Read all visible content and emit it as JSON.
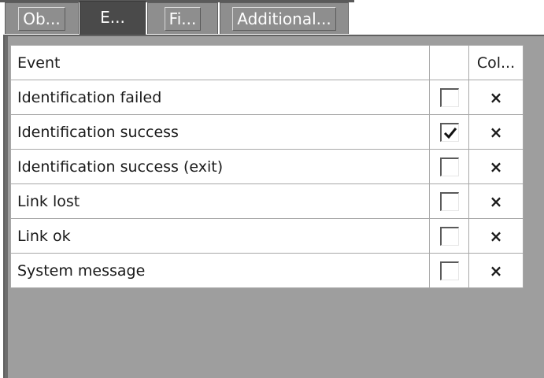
{
  "tabs": [
    {
      "label": "Ob...",
      "active": false
    },
    {
      "label": "E...",
      "active": true
    },
    {
      "label": "Fi...",
      "active": false
    },
    {
      "label": "Additional...",
      "active": false
    }
  ],
  "grid": {
    "headers": {
      "event": "Event",
      "check": "",
      "col": "Col..."
    },
    "rows": [
      {
        "event": "Identification failed",
        "checked": false,
        "action": "×"
      },
      {
        "event": "Identification success",
        "checked": true,
        "action": "×"
      },
      {
        "event": "Identification success (exit)",
        "checked": false,
        "action": "×"
      },
      {
        "event": "Link lost",
        "checked": false,
        "action": "×"
      },
      {
        "event": "Link ok",
        "checked": false,
        "action": "×"
      },
      {
        "event": "System message",
        "checked": false,
        "action": "×"
      }
    ]
  },
  "icons": {
    "checked": "checkmark-icon",
    "remove": "close-icon"
  },
  "colors": {
    "panel_bg": "#9e9e9e",
    "active_tab": "#4a4a4a",
    "inactive_tab": "#8e8e8e"
  }
}
